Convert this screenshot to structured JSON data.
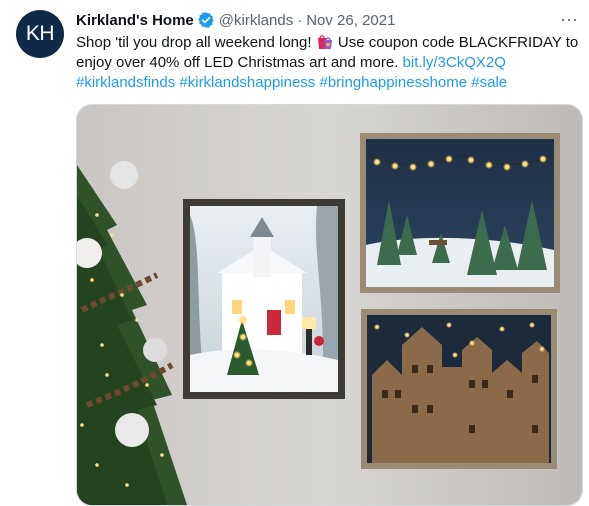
{
  "tweet": {
    "avatar": {
      "initials": "KH",
      "color": "#0f2a47"
    },
    "author": {
      "display_name": "Kirkland's Home",
      "verified_icon": "verified-badge-icon",
      "handle": "@kirklands",
      "separator": "·",
      "date": "Nov 26, 2021"
    },
    "more_icon": "more-icon",
    "more_label": "···",
    "body": {
      "text_start": "Shop 'til you drop all weekend long!",
      "emoji": "shopping-bags-emoji",
      "text_mid": "Use coupon code BLACKFRIDAY to enjoy over 40% off LED Christmas art and more.",
      "link": "bit.ly/3CkQX2Q",
      "hashtags": [
        "#kirklandsfinds",
        "#kirklandshappiness",
        "#bringhappinesshome",
        "#sale"
      ]
    },
    "media": {
      "description_icon": "tweet-photo",
      "accent": "#1d9bf0"
    }
  }
}
